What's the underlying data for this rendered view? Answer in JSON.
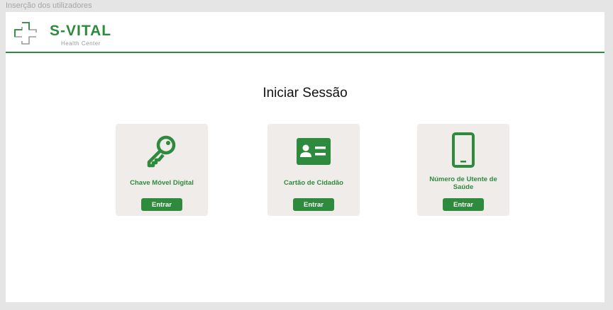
{
  "frame_label": "Inserção dos utilizadores",
  "brand": {
    "name": "S-VITAL",
    "subtitle": "Health Center",
    "icon": "medical-cross-icon"
  },
  "page": {
    "title": "Iniciar Sessão"
  },
  "options": [
    {
      "label": "Chave Móvel Digital",
      "icon": "key-icon",
      "button": "Entrar"
    },
    {
      "label": "Cartão de Cidadão",
      "icon": "id-card-icon",
      "button": "Entrar"
    },
    {
      "label": "Número de Utente de Saúde",
      "icon": "smartphone-icon",
      "button": "Entrar"
    }
  ],
  "colors": {
    "accent": "#2e8b3e",
    "card_background": "#f0ecea",
    "canvas": "#e5e5e5"
  }
}
